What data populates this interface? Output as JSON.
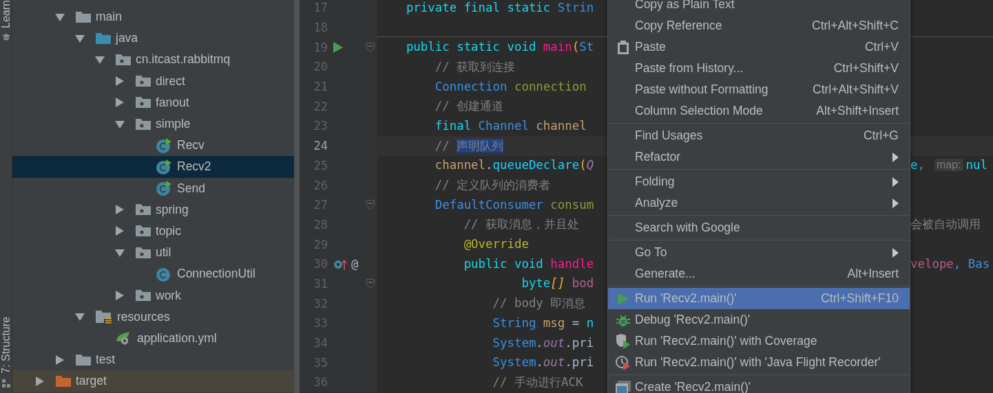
{
  "tool_strip": {
    "top_label": "Learn",
    "bottom_label": "7: Structure"
  },
  "project_tree": {
    "items": [
      {
        "children": [
          {
            "label": "main",
            "kind": "folder",
            "expanded": true,
            "selected": false,
            "children": [
              {
                "label": "java",
                "kind": "source-folder",
                "expanded": true,
                "selected": false,
                "children": [
                  {
                    "label": "cn.itcast.rabbitmq",
                    "kind": "package",
                    "expanded": true,
                    "selected": false,
                    "children": [
                      {
                        "label": "direct",
                        "kind": "package",
                        "expanded": false,
                        "selected": false
                      },
                      {
                        "label": "fanout",
                        "kind": "package",
                        "expanded": false,
                        "selected": false
                      },
                      {
                        "label": "simple",
                        "kind": "package",
                        "expanded": true,
                        "selected": false,
                        "children": [
                          {
                            "label": "Recv",
                            "kind": "class",
                            "runnable": true,
                            "selected": false
                          },
                          {
                            "label": "Recv2",
                            "kind": "class",
                            "runnable": true,
                            "selected": true
                          },
                          {
                            "label": "Send",
                            "kind": "class",
                            "runnable": true,
                            "selected": false
                          }
                        ]
                      },
                      {
                        "label": "spring",
                        "kind": "package",
                        "expanded": false,
                        "selected": false
                      },
                      {
                        "label": "topic",
                        "kind": "package",
                        "expanded": false,
                        "selected": false
                      },
                      {
                        "label": "util",
                        "kind": "package",
                        "expanded": true,
                        "selected": false,
                        "children": [
                          {
                            "label": "ConnectionUtil",
                            "kind": "class",
                            "runnable": false,
                            "selected": false
                          }
                        ]
                      },
                      {
                        "label": "work",
                        "kind": "package",
                        "expanded": false,
                        "selected": false
                      }
                    ]
                  }
                ]
              },
              {
                "label": "resources",
                "kind": "resources",
                "expanded": true,
                "selected": false,
                "children": [
                  {
                    "label": "application.yml",
                    "kind": "spring-config",
                    "selected": false
                  }
                ]
              }
            ]
          },
          {
            "label": "test",
            "kind": "folder",
            "expanded": false,
            "selected": false
          }
        ]
      },
      {
        "label": "target",
        "kind": "excluded-folder",
        "expanded": false,
        "selected": false
      }
    ]
  },
  "editor": {
    "lines": [
      {
        "number": "17",
        "current": false,
        "fold": false,
        "separator_below": false,
        "tokens": [
          {
            "text": "    private final static ",
            "kind": "keyword"
          },
          {
            "text": "Strin",
            "kind": "type"
          }
        ]
      },
      {
        "number": "18",
        "current": false,
        "fold": false,
        "separator_below": true
      },
      {
        "number": "19",
        "current": false,
        "fold": true,
        "separator_below": false,
        "kind": "runnable-method",
        "tokens": [
          {
            "text": "    public static void ",
            "kind": "keyword"
          },
          {
            "text": "main",
            "kind": "method"
          },
          {
            "text": "(",
            "kind": "paren"
          },
          {
            "text": "St",
            "kind": "type"
          }
        ]
      },
      {
        "number": "20",
        "current": false,
        "fold": false,
        "separator_below": false,
        "tokens": [
          {
            "text": "        // 获取到连接",
            "kind": "comment"
          }
        ]
      },
      {
        "number": "21",
        "current": false,
        "fold": false,
        "separator_below": false,
        "tokens": [
          {
            "text": "        Connection ",
            "kind": "type"
          },
          {
            "text": "connection",
            "kind": "variable"
          }
        ]
      },
      {
        "number": "22",
        "current": false,
        "fold": false,
        "separator_below": false,
        "tokens": [
          {
            "text": "        // 创建通道",
            "kind": "comment"
          }
        ]
      },
      {
        "number": "23",
        "current": false,
        "fold": false,
        "separator_below": false,
        "tokens": [
          {
            "text": "        final ",
            "kind": "keyword"
          },
          {
            "text": "Channel ",
            "kind": "type"
          },
          {
            "text": "channel",
            "kind": "local"
          }
        ]
      },
      {
        "number": "24",
        "current": true,
        "fold": false,
        "separator_below": false,
        "tokens": [
          {
            "text": "        // ",
            "kind": "comment"
          },
          {
            "text": "声明队列",
            "kind": "selection"
          }
        ]
      },
      {
        "number": "25",
        "current": false,
        "fold": false,
        "separator_below": false,
        "tokens": [
          {
            "text": "        channel",
            "kind": "local"
          },
          {
            "text": ".",
            "kind": "plain"
          },
          {
            "text": "queueDeclare",
            "kind": "call"
          },
          {
            "text": "(",
            "kind": "paren"
          },
          {
            "text": "Q",
            "kind": "constant"
          }
        ],
        "right": [
          {
            "kind": "code",
            "tokens": [
              {
                "text": "e",
                "kind": "keyword"
              },
              {
                "text": ",",
                "kind": "type"
              }
            ]
          },
          {
            "kind": "hint",
            "text": "map:"
          },
          {
            "kind": "code",
            "tokens": [
              {
                "text": "nul",
                "kind": "keyword"
              }
            ]
          }
        ]
      },
      {
        "number": "26",
        "current": false,
        "fold": false,
        "separator_below": false,
        "tokens": [
          {
            "text": "        // 定义队列的消费者",
            "kind": "comment"
          }
        ]
      },
      {
        "number": "27",
        "current": false,
        "fold": true,
        "separator_below": false,
        "tokens": [
          {
            "text": "        DefaultConsumer ",
            "kind": "type"
          },
          {
            "text": "consum",
            "kind": "variable"
          }
        ]
      },
      {
        "number": "28",
        "current": false,
        "fold": false,
        "separator_below": false,
        "tokens": [
          {
            "text": "            // 获取消息，并且处",
            "kind": "comment"
          }
        ],
        "right": [
          {
            "kind": "code",
            "tokens": [
              {
                "text": "会被自动调用",
                "kind": "comment"
              }
            ]
          }
        ]
      },
      {
        "number": "29",
        "current": false,
        "fold": false,
        "separator_below": false,
        "tokens": [
          {
            "text": "            @Override",
            "kind": "annotation"
          }
        ]
      },
      {
        "number": "30",
        "current": false,
        "fold": false,
        "separator_below": false,
        "kind": "override",
        "gutter_mark": "@",
        "tokens": [
          {
            "text": "            public void ",
            "kind": "keyword"
          },
          {
            "text": "handle",
            "kind": "method"
          }
        ],
        "right": [
          {
            "kind": "code",
            "tokens": [
              {
                "text": "velope",
                "kind": "param"
              },
              {
                "text": ", ",
                "kind": "type"
              },
              {
                "text": "Bas",
                "kind": "type"
              }
            ]
          }
        ]
      },
      {
        "number": "31",
        "current": false,
        "fold": true,
        "separator_below": false,
        "tokens": [
          {
            "text": "                    byte",
            "kind": "keyword"
          },
          {
            "text": "[] ",
            "kind": "bracket"
          },
          {
            "text": "bod",
            "kind": "param"
          }
        ]
      },
      {
        "number": "32",
        "current": false,
        "fold": false,
        "separator_below": false,
        "tokens": [
          {
            "text": "                // body 即消息",
            "kind": "comment"
          }
        ]
      },
      {
        "number": "33",
        "current": false,
        "fold": false,
        "separator_below": false,
        "tokens": [
          {
            "text": "                String ",
            "kind": "type"
          },
          {
            "text": "msg",
            "kind": "local"
          },
          {
            "text": " = ",
            "kind": "plain"
          },
          {
            "text": "n",
            "kind": "keyword"
          }
        ]
      },
      {
        "number": "34",
        "current": false,
        "fold": false,
        "separator_below": false,
        "tokens": [
          {
            "text": "                System",
            "kind": "type"
          },
          {
            "text": ".",
            "kind": "plain"
          },
          {
            "text": "out",
            "kind": "field"
          },
          {
            "text": ".pri",
            "kind": "plain"
          }
        ]
      },
      {
        "number": "35",
        "current": false,
        "fold": false,
        "separator_below": false,
        "tokens": [
          {
            "text": "                System",
            "kind": "type"
          },
          {
            "text": ".",
            "kind": "plain"
          },
          {
            "text": "out",
            "kind": "field"
          },
          {
            "text": ".pri",
            "kind": "plain"
          }
        ]
      },
      {
        "number": "36",
        "current": false,
        "fold": false,
        "separator_below": false,
        "tokens": [
          {
            "text": "                // 手动进行ACK",
            "kind": "comment"
          }
        ]
      }
    ]
  },
  "context_menu": {
    "groups": [
      [
        {
          "label": "Copy as Plain Text",
          "selected": false
        },
        {
          "label": "Copy Reference",
          "shortcut": "Ctrl+Alt+Shift+C",
          "selected": false
        },
        {
          "label": "Paste",
          "shortcut": "Ctrl+V",
          "kind": "paste",
          "selected": false
        },
        {
          "label": "Paste from History...",
          "shortcut": "Ctrl+Shift+V",
          "selected": false
        },
        {
          "label": "Paste without Formatting",
          "shortcut": "Ctrl+Alt+Shift+V",
          "selected": false
        },
        {
          "label": "Column Selection Mode",
          "shortcut": "Alt+Shift+Insert",
          "selected": false
        }
      ],
      [
        {
          "label": "Find Usages",
          "shortcut": "Ctrl+G",
          "selected": false
        },
        {
          "label": "Refactor",
          "submenu": true,
          "selected": false
        }
      ],
      [
        {
          "label": "Folding",
          "submenu": true,
          "selected": false
        },
        {
          "label": "Analyze",
          "submenu": true,
          "selected": false
        }
      ],
      [
        {
          "label": "Search with Google",
          "selected": false
        }
      ],
      [
        {
          "label": "Go To",
          "submenu": true,
          "selected": false
        },
        {
          "label": "Generate...",
          "shortcut": "Alt+Insert",
          "selected": false
        }
      ],
      [
        {
          "label": "Run 'Recv2.main()'",
          "shortcut": "Ctrl+Shift+F10",
          "kind": "run",
          "selected": true
        },
        {
          "label": "Debug 'Recv2.main()'",
          "kind": "debug",
          "selected": false
        },
        {
          "label": "Run 'Recv2.main()' with Coverage",
          "kind": "coverage",
          "selected": false
        },
        {
          "label": "Run 'Recv2.main()' with 'Java Flight Recorder'",
          "kind": "profiler",
          "selected": false
        }
      ],
      [
        {
          "label": "Create 'Recv2.main()'",
          "kind": "create",
          "selected": false
        }
      ]
    ]
  }
}
